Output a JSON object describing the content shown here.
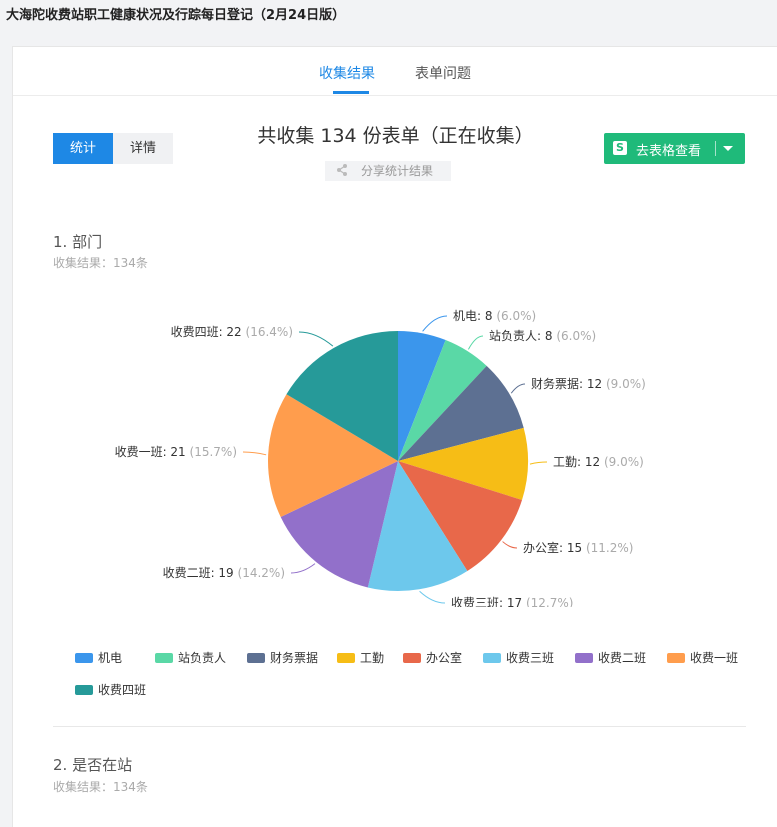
{
  "page": {
    "title": "大海陀收费站职工健康状况及行踪每日登记（2月24日版）"
  },
  "tabs": [
    {
      "label": "收集结果",
      "active": true
    },
    {
      "label": "表单问题",
      "active": false
    }
  ],
  "view_toggle": {
    "stats": "统计",
    "details": "详情",
    "selected": "统计"
  },
  "summary": {
    "title": "共收集 134 份表单（正在收集）",
    "share": "分享统计结果"
  },
  "sheet_button": {
    "icon_letter": "S",
    "label": "去表格查看"
  },
  "questions": [
    {
      "title": "1.  部门",
      "subtitle": "收集结果：134条"
    },
    {
      "title": "2.  是否在站",
      "subtitle": "收集结果：134条"
    }
  ],
  "chart_data": {
    "type": "pie",
    "total": 134,
    "slices": [
      {
        "name": "机电",
        "value": 8,
        "percent": "6.0%",
        "color": "#3b96ec",
        "label": "机电: 8",
        "pct_label": "(6.0%)"
      },
      {
        "name": "站负责人",
        "value": 8,
        "percent": "6.0%",
        "color": "#5ad8a6",
        "label": "站负责人: 8",
        "pct_label": "(6.0%)"
      },
      {
        "name": "财务票据",
        "value": 12,
        "percent": "9.0%",
        "color": "#5d7092",
        "label": "财务票据: 12",
        "pct_label": "(9.0%)"
      },
      {
        "name": "工勤",
        "value": 12,
        "percent": "9.0%",
        "color": "#f6bd16",
        "label": "工勤: 12",
        "pct_label": "(9.0%)"
      },
      {
        "name": "办公室",
        "value": 15,
        "percent": "11.2%",
        "color": "#e8684a",
        "label": "办公室: 15",
        "pct_label": "(11.2%)"
      },
      {
        "name": "收费三班",
        "value": 17,
        "percent": "12.7%",
        "color": "#6dc8ec",
        "label": "收费三班: 17",
        "pct_label": "(12.7%)"
      },
      {
        "name": "收费二班",
        "value": 19,
        "percent": "14.2%",
        "color": "#9270ca",
        "label": "收费二班: 19",
        "pct_label": "(14.2%)"
      },
      {
        "name": "收费一班",
        "value": 21,
        "percent": "15.7%",
        "color": "#ff9d4d",
        "label": "收费一班: 21",
        "pct_label": "(15.7%)"
      },
      {
        "name": "收费四班",
        "value": 22,
        "percent": "16.4%",
        "color": "#269a99",
        "label": "收费四班: 22",
        "pct_label": "(16.4%)"
      }
    ]
  }
}
